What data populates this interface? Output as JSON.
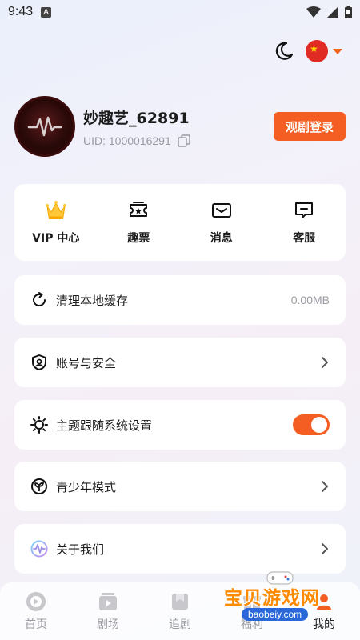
{
  "status_bar": {
    "time": "9:43",
    "notif": "A"
  },
  "colors": {
    "accent": "#f45e22",
    "text": "#1c1c1c",
    "muted": "#9a9aa2"
  },
  "profile": {
    "username": "妙趣艺_62891",
    "uid": "UID: 1000016291",
    "login_label": "观剧登录"
  },
  "quick_actions": [
    {
      "label": "VIP 中心",
      "icon": "crown-icon"
    },
    {
      "label": "趣票",
      "icon": "ticket-icon"
    },
    {
      "label": "消息",
      "icon": "mail-icon"
    },
    {
      "label": "客服",
      "icon": "chat-icon"
    }
  ],
  "settings": {
    "cache": {
      "label": "清理本地缓存",
      "value": "0.00MB",
      "icon": "refresh-icon"
    },
    "account": {
      "label": "账号与安全",
      "icon": "shield-icon"
    },
    "theme": {
      "label": "主题跟随系统设置",
      "icon": "sun-icon",
      "enabled": true
    },
    "youth": {
      "label": "青少年模式",
      "icon": "sprout-icon"
    },
    "about": {
      "label": "关于我们",
      "icon": "about-icon"
    }
  },
  "bottom_nav": [
    {
      "label": "首页",
      "icon": "play-icon"
    },
    {
      "label": "剧场",
      "icon": "theater-icon"
    },
    {
      "label": "追剧",
      "icon": "bookmark-icon"
    },
    {
      "label": "福利",
      "icon": "gift-icon"
    },
    {
      "label": "我的",
      "icon": "user-icon",
      "active": true
    }
  ],
  "watermark": {
    "text": "宝贝游戏网",
    "url": "baobeiy.com"
  }
}
